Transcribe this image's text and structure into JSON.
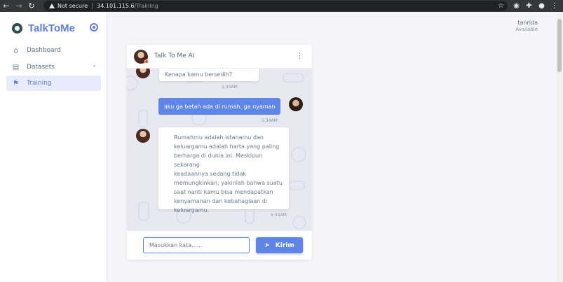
{
  "browser": {
    "security_label": "Not secure",
    "url_host": "34.101.115.6",
    "url_path": "/Training"
  },
  "sidebar": {
    "brand": "TalkToMe",
    "items": [
      {
        "label": "Dashboard",
        "icon": "home-icon"
      },
      {
        "label": "Datasets",
        "icon": "archive-icon"
      },
      {
        "label": "Training",
        "icon": "running-icon",
        "active": true
      }
    ]
  },
  "user": {
    "name": "tanrida",
    "status": "Available"
  },
  "chat": {
    "title": "Talk To Me AI",
    "messages": [
      {
        "from": "ai",
        "text": "Kenapa kamu bersedih?",
        "time": "1:34AM"
      },
      {
        "from": "user",
        "text": "aku ga betah ada di rumah, ga nyaman",
        "time": "1:34AM"
      },
      {
        "from": "ai",
        "lines": [
          "Rumahmu adalah istanamu dan",
          "keluargamu adalah harta yang paling",
          "berharga di dunia ini. Meskipun sekarang",
          "keadaannya sedang tidak",
          "memungkinkan, yakinlah bahwa suatu",
          "saat nanti kamu bisa mendapatkan",
          "kenyamanan dan kebahagiaan di",
          "keluargamu."
        ],
        "time": "1:34AM"
      }
    ],
    "input_placeholder": "Masukkan kata......",
    "send_label": "Kirim"
  },
  "colors": {
    "accent": "#5e7ee0",
    "user_bubble": "#5f85e8",
    "chat_bg": "#e8e8f0"
  }
}
